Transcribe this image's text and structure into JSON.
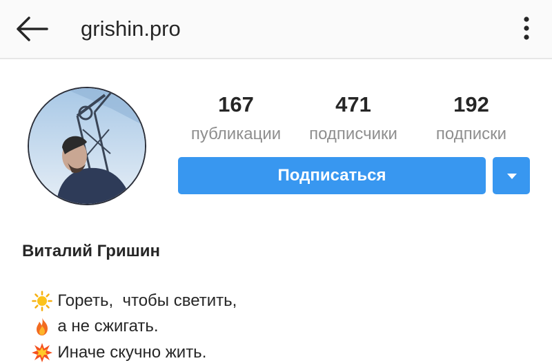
{
  "header": {
    "username": "grishin.pro",
    "back_icon": "arrow-left-icon",
    "more_icon": "more-vertical-icon"
  },
  "profile": {
    "avatar_icon": "profile-photo",
    "stats": [
      {
        "value": "167",
        "label": "публикации"
      },
      {
        "value": "471",
        "label": "подписчики"
      },
      {
        "value": "192",
        "label": "подписки"
      }
    ],
    "follow_label": "Подписаться",
    "dropdown_icon": "caret-down-icon",
    "full_name": "Виталий Гришин",
    "bio": [
      {
        "icon": "sun-emoji-icon",
        "text": "Гореть,  чтобы светить,"
      },
      {
        "icon": "fire-emoji-icon",
        "text": "а не сжигать."
      },
      {
        "icon": "collision-emoji-icon",
        "text": "Иначе скучно жить."
      }
    ]
  },
  "colors": {
    "accent": "#3897f0",
    "text": "#262626",
    "muted": "#8e8e8e",
    "topbar_bg": "#fafafa"
  }
}
